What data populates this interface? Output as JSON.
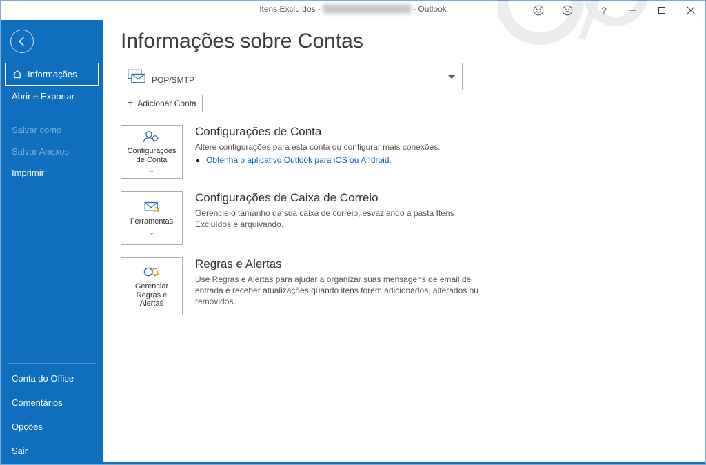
{
  "titlebar": {
    "folder": "Itens Excluídos",
    "sep1": " - ",
    "account_masked": "xxxxxxxx@xxxxxxx.xxx",
    "sep2": " - ",
    "app": "Outlook"
  },
  "sidebar": {
    "info": "Informações",
    "open_export": "Abrir e Exportar",
    "save_as": "Salvar como",
    "save_attachments": "Salvar Anexos",
    "print": "Imprimir",
    "office_account": "Conta do Office",
    "feedback": "Comentários",
    "options": "Opções",
    "exit": "Sair"
  },
  "main": {
    "heading": "Informações sobre Contas",
    "account_type": "POP/SMTP",
    "add_account": "Adicionar Conta",
    "sections": {
      "account_settings": {
        "tile": "Configurações de Conta",
        "title": "Configurações de Conta",
        "desc": "Altere configurações para esta conta ou configurar mais conexões.",
        "link": "Obtenha o aplicativo Outlook para iOS ou Android."
      },
      "mailbox": {
        "tile": "Ferramentas",
        "title": "Configurações de Caixa de Correio",
        "desc": "Gerencie o tamanho da sua caixa de correio, esvaziando a pasta Itens Excluídos e arquivando."
      },
      "rules": {
        "tile": "Gerenciar Regras e Alertas",
        "title": "Regras e Alertas",
        "desc": "Use Regras e Alertas para ajudar a organizar suas mensagens de email de entrada e receber atualizações quando itens forem adicionados, alterados ou removidos."
      }
    }
  }
}
